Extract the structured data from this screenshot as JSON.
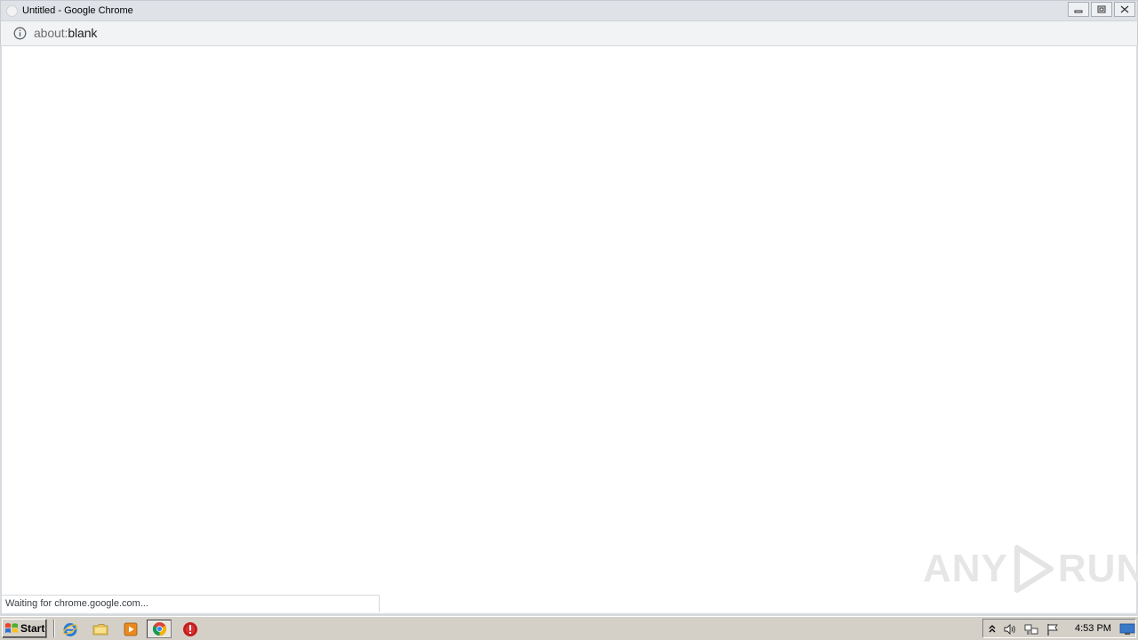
{
  "window": {
    "title": "Untitled - Google Chrome"
  },
  "omnibox": {
    "url_scheme": "about:",
    "url_rest": "blank"
  },
  "status": {
    "text": "Waiting for chrome.google.com..."
  },
  "watermark": {
    "left": "ANY",
    "right": "RUN"
  },
  "taskbar": {
    "start_label": "Start",
    "pinned": [
      "internet-explorer-icon",
      "folder-icon",
      "media-player-icon",
      "chrome-icon",
      "stop-icon"
    ],
    "clock": "4:53 PM"
  },
  "colors": {
    "accent_red": "#cc1f1f",
    "chrome_titlebar": "#dfe3e8",
    "taskbar": "#d4d0c8"
  }
}
